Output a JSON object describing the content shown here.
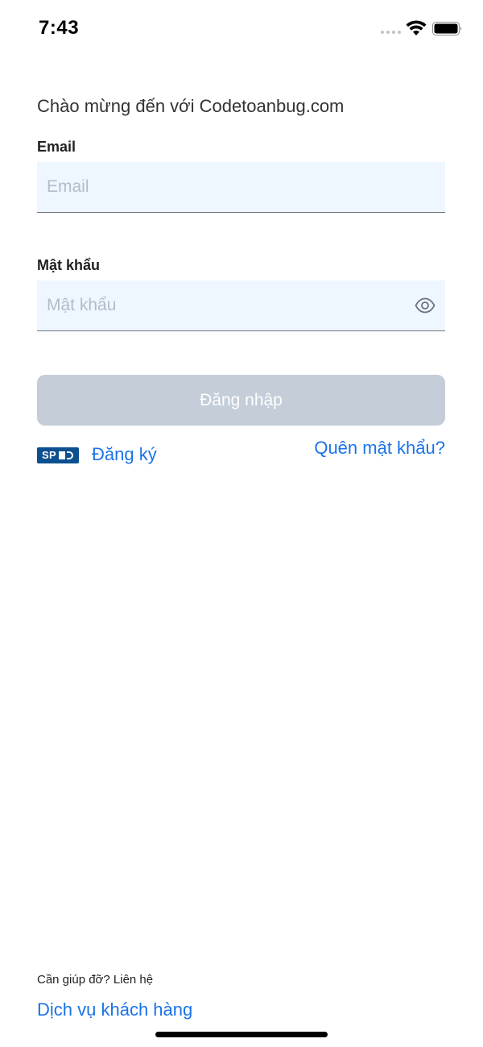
{
  "status_bar": {
    "time": "7:43",
    "icons": [
      "signal-dots-icon",
      "wifi-icon",
      "battery-icon"
    ]
  },
  "welcome_text": "Chào mừng đến với Codetoanbug.com",
  "email": {
    "label": "Email",
    "placeholder": "Email",
    "value": ""
  },
  "password": {
    "label": "Mật khẩu",
    "placeholder": "Mật khẩu",
    "value": "",
    "toggle_icon": "eye-icon"
  },
  "login_button": {
    "label": "Đăng nhập",
    "enabled": false
  },
  "spid_badge": {
    "text": "SP"
  },
  "register_link": "Đăng ký",
  "forgot_password_link": "Quên mật khẩu?",
  "footer": {
    "help_text": "Cần giúp đỡ? Liên hệ",
    "support_link": "Dịch vụ khách hàng"
  },
  "colors": {
    "link": "#1a73e8",
    "input_bg": "#eef6ff",
    "button_disabled": "#c4cdd8",
    "spid_blue": "#0b4f8f"
  }
}
